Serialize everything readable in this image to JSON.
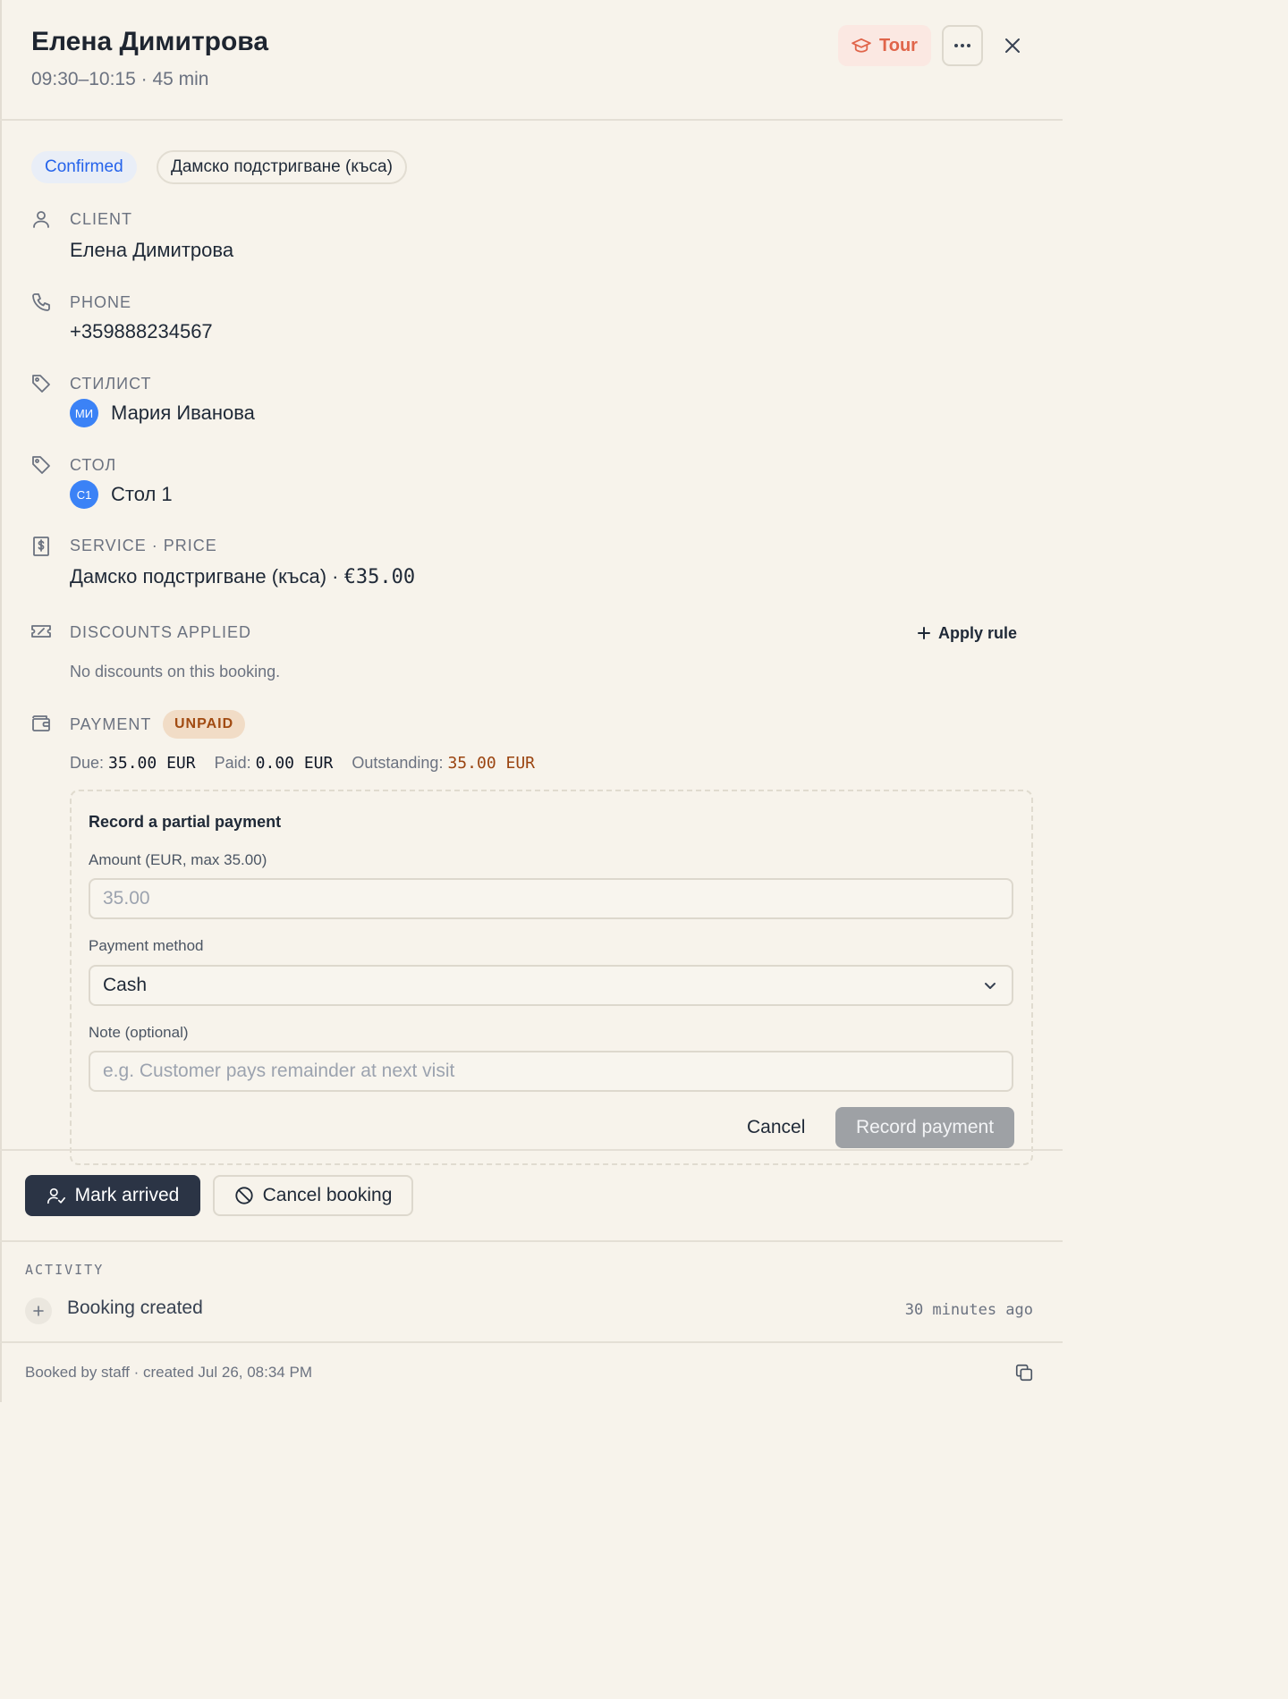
{
  "header": {
    "title": "Елена Димитрова",
    "subtitle": "09:30–10:15 · 45 min",
    "tour_label": "Tour"
  },
  "chips": {
    "status": "Confirmed",
    "service": "Дамско подстригване (къса)"
  },
  "client": {
    "label": "CLIENT",
    "value": "Елена Димитрова"
  },
  "phone": {
    "label": "PHONE",
    "value": "+359888234567"
  },
  "stylist": {
    "label": "СТИЛИСТ",
    "initials": "МИ",
    "name": "Мария Иванова"
  },
  "table": {
    "label": "СТОЛ",
    "initials": "С1",
    "name": "Стол 1"
  },
  "service_price": {
    "label": "SERVICE · PRICE",
    "service": "Дамско подстригване (къса)",
    "separator": "·",
    "price": "€35.00"
  },
  "discounts": {
    "label": "DISCOUNTS APPLIED",
    "apply_label": "Apply rule",
    "empty_text": "No discounts on this booking."
  },
  "payment": {
    "label": "PAYMENT",
    "badge": "UNPAID",
    "due_label": "Due:",
    "due_value": "35.00 EUR",
    "paid_label": "Paid:",
    "paid_value": "0.00 EUR",
    "outstanding_label": "Outstanding:",
    "outstanding_value": "35.00 EUR"
  },
  "partial_payment": {
    "title": "Record a partial payment",
    "amount_label": "Amount (EUR, max 35.00)",
    "amount_placeholder": "35.00",
    "method_label": "Payment method",
    "method_value": "Cash",
    "note_label": "Note (optional)",
    "note_placeholder": "e.g. Customer pays remainder at next visit",
    "cancel_label": "Cancel",
    "submit_label": "Record payment"
  },
  "actions": {
    "mark_arrived": "Mark arrived",
    "cancel_booking": "Cancel booking"
  },
  "activity": {
    "label": "ACTIVITY",
    "items": [
      {
        "text": "Booking created",
        "time": "30 minutes ago"
      }
    ]
  },
  "footer": {
    "text": "Booked by staff · created Jul 26, 08:34 PM"
  },
  "colors": {
    "background": "#f7f3eb",
    "primary_button": "#2b3445",
    "status_blue": "#2563eb",
    "tour_accent": "#e0654a",
    "unpaid_text": "#a14b12",
    "avatar_blue": "#3b82f6"
  }
}
